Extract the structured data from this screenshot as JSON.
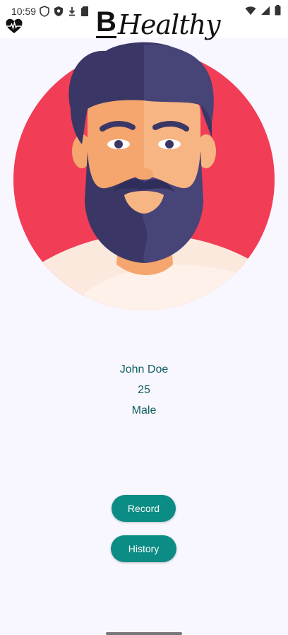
{
  "status_bar": {
    "time": "10:59",
    "left_icons": [
      "shield-outline-icon",
      "shield-filled-icon",
      "download-icon",
      "sim-card-icon"
    ],
    "right_icons": [
      "wifi-icon",
      "signal-icon",
      "battery-icon"
    ]
  },
  "app_bar": {
    "logo_icon": "heart-pulse-icon",
    "brand_b": "B",
    "brand_text": "Healthy"
  },
  "profile": {
    "avatar": "bearded-man-avatar",
    "avatar_bg_color": "#f23d56",
    "name": "John Doe",
    "age": "25",
    "gender": "Male"
  },
  "actions": {
    "record_label": "Record",
    "history_label": "History",
    "button_color": "#0b8c84"
  }
}
